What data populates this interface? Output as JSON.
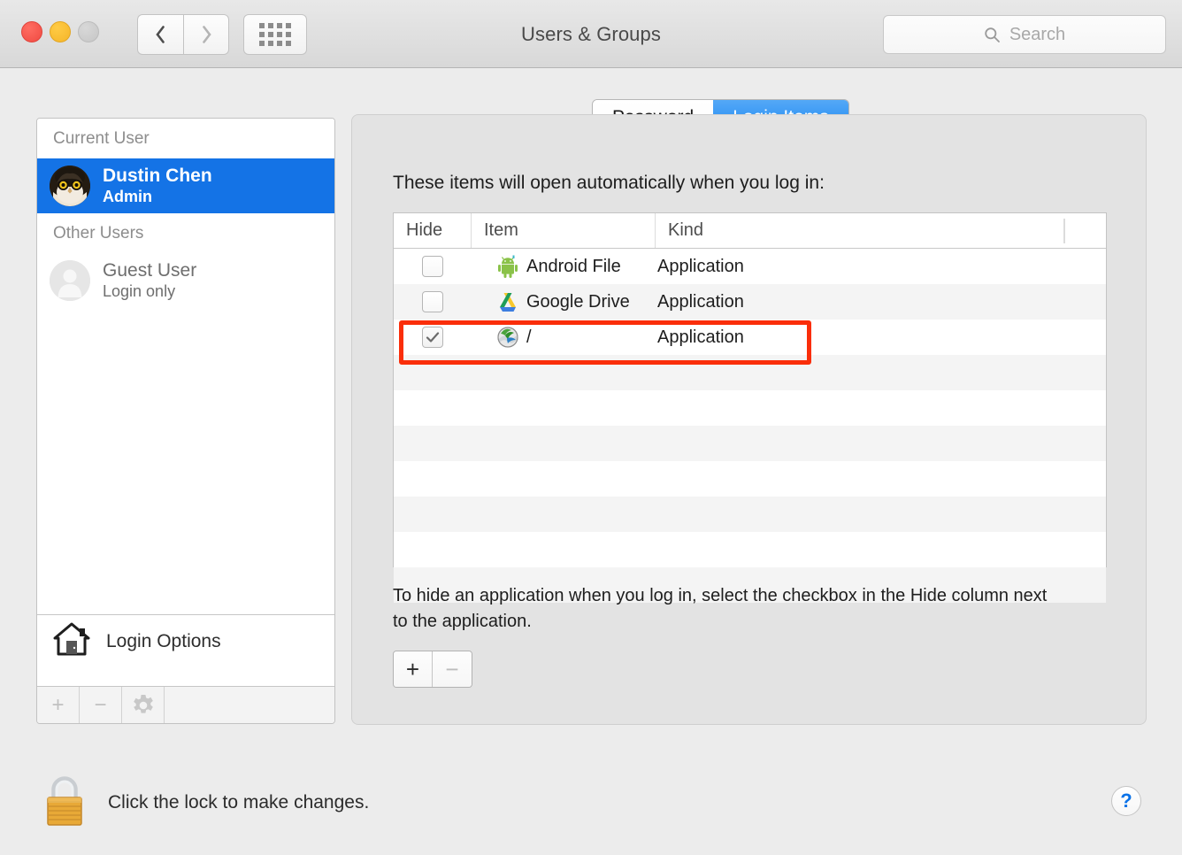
{
  "window": {
    "title": "Users & Groups",
    "traffic_lights": [
      "close",
      "minimize",
      "zoom"
    ],
    "nav_back_icon": "chevron-left-icon",
    "nav_forward_icon": "chevron-right-icon",
    "grid_icon": "show-all-grid-icon"
  },
  "search": {
    "placeholder": "Search",
    "icon": "search-icon",
    "value": ""
  },
  "sidebar": {
    "groups": [
      {
        "header": "Current User",
        "users": [
          {
            "name": "Dustin Chen",
            "role": "Admin",
            "avatar_icon": "owl-avatar",
            "selected": true
          }
        ]
      },
      {
        "header": "Other Users",
        "users": [
          {
            "name": "Guest User",
            "role": "Login only",
            "avatar_icon": "person-silhouette-avatar",
            "selected": false
          }
        ]
      }
    ],
    "login_options": {
      "label": "Login Options",
      "icon": "home-icon"
    },
    "toolbar": [
      {
        "label": "+",
        "name": "add-user-button",
        "enabled": false
      },
      {
        "label": "−",
        "name": "remove-user-button",
        "enabled": false
      },
      {
        "label": "gear",
        "name": "settings-gear-button",
        "enabled": false
      }
    ]
  },
  "tabs": [
    {
      "label": "Password",
      "active": false
    },
    {
      "label": "Login Items",
      "active": true
    }
  ],
  "main": {
    "intro": "These items will open automatically when you log in:",
    "help_text": "To hide an application when you log in, select the checkbox in the Hide column next to the application.",
    "add_label": "+",
    "remove_label": "−",
    "table": {
      "columns": [
        "Hide",
        "Item",
        "Kind"
      ],
      "rows": [
        {
          "hide": false,
          "item": "Android File",
          "kind": "Application",
          "icon": "android-icon",
          "highlighted": false
        },
        {
          "hide": false,
          "item": "Google Drive",
          "kind": "Application",
          "icon": "google-drive-icon",
          "highlighted": false
        },
        {
          "hide": true,
          "item": "/",
          "kind": "Application",
          "icon": "globe-network-icon",
          "highlighted": true
        }
      ],
      "empty_rows": 7
    }
  },
  "footer": {
    "lock_label": "Click the lock to make changes.",
    "lock_icon": "padlock-closed-icon",
    "help_label": "?"
  },
  "colors": {
    "accent_blue": "#1473e6",
    "tab_active": "#1b87f0",
    "highlight_red": "#fa2e0a",
    "window_bg": "#ececec",
    "panel_bg": "#e3e3e3"
  }
}
